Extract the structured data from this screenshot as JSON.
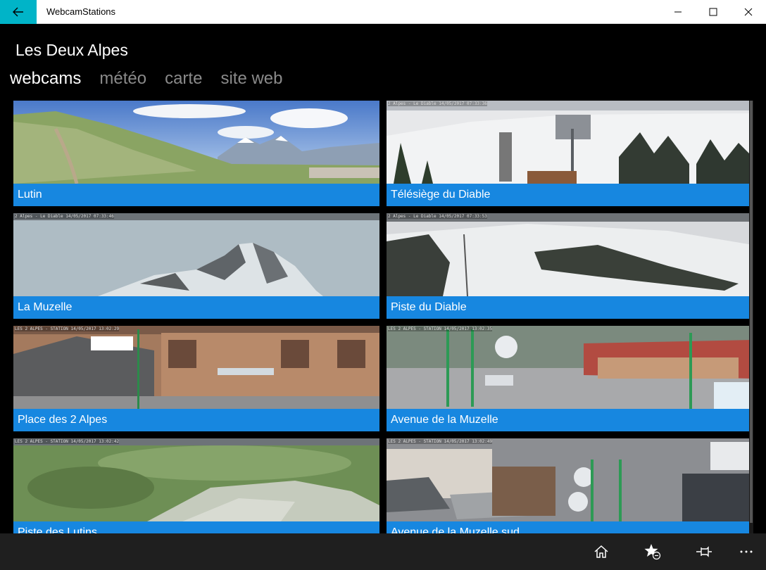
{
  "window": {
    "title": "WebcamStations"
  },
  "page": {
    "title": "Les Deux Alpes"
  },
  "pivot": [
    {
      "label": "webcams",
      "active": true
    },
    {
      "label": "météo",
      "active": false
    },
    {
      "label": "carte",
      "active": false
    },
    {
      "label": "site web",
      "active": false
    }
  ],
  "webcams": [
    {
      "name": "Lutin",
      "stamp": ""
    },
    {
      "name": "Télésiège du Diable",
      "stamp": "2 Alpes - Le Diable 14/05/2017 07:33:36"
    },
    {
      "name": "La Muzelle",
      "stamp": "2 Alpes - Le Diable 14/05/2017 07:33:46"
    },
    {
      "name": "Piste du Diable",
      "stamp": "2 Alpes - Le Diable 14/05/2017 07:33:53"
    },
    {
      "name": "Place des 2 Alpes",
      "stamp": "LES 2 ALPES - STATION 14/05/2017 13:02:29"
    },
    {
      "name": "Avenue de la Muzelle",
      "stamp": "LES 2 ALPES - STATION 14/05/2017 13:02:35"
    },
    {
      "name": "Piste des Lutins",
      "stamp": "LES 2 ALPES - STATION 14/05/2017 13:02:42"
    },
    {
      "name": "Avenue de la Muzelle sud",
      "stamp": "LES 2 ALPES - STATION 14/05/2017 13:02:49"
    }
  ],
  "icons": {
    "back": "back-arrow-icon",
    "minimize": "minimize-icon",
    "maximize": "maximize-icon",
    "close": "close-icon",
    "home": "home-icon",
    "favorite": "favorite-star-icon",
    "pin": "pin-icon",
    "more": "more-icon"
  },
  "colors": {
    "accent": "#1787e0",
    "back_button": "#00b4c8"
  }
}
